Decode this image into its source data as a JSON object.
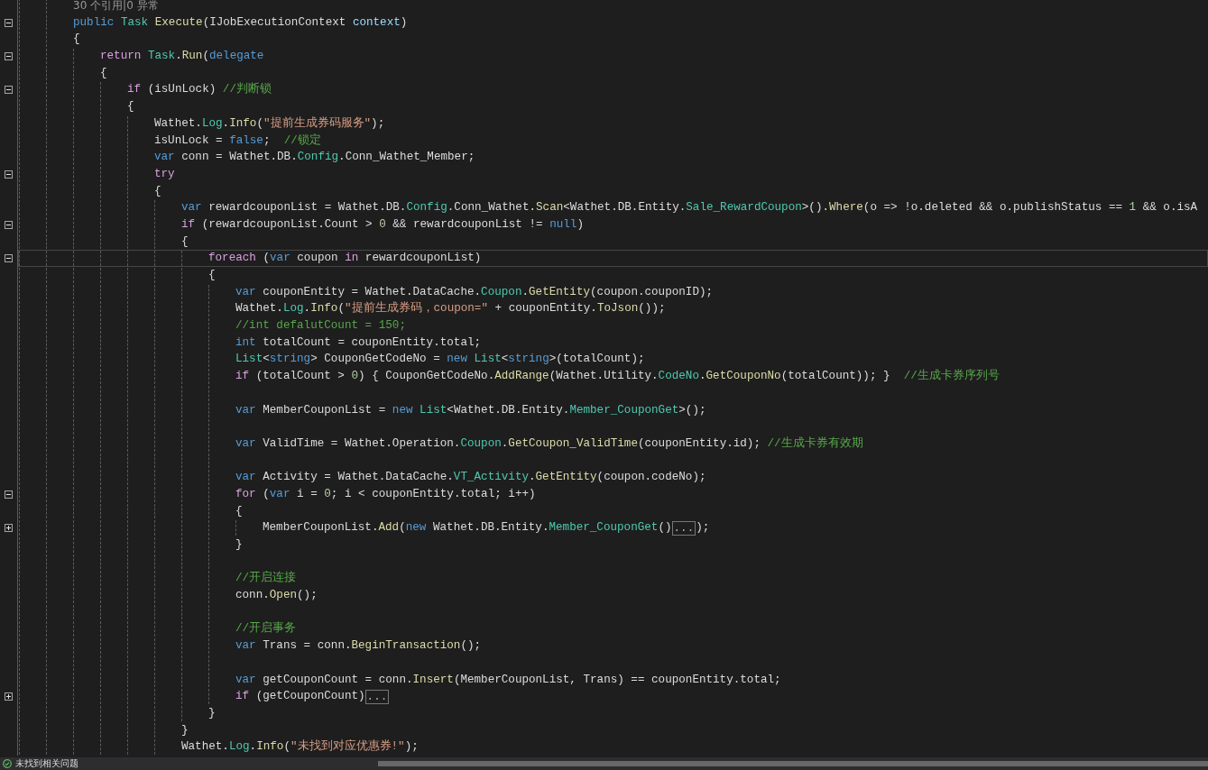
{
  "code": [
    {
      "kind": "codelens",
      "tokens": [
        {
          "kind": "lens",
          "text": "30 个引用|0 异常"
        }
      ]
    },
    {
      "kind": "code",
      "expanded": true,
      "tokens": [
        {
          "kind": "kw",
          "text": "public"
        },
        {
          "kind": "type",
          "text": " Task"
        },
        {
          "kind": "method",
          "text": " Execute"
        },
        {
          "kind": "plain",
          "text": "(IJobExecutionContext "
        },
        {
          "kind": "param",
          "text": "context"
        },
        {
          "kind": "plain",
          "text": ")"
        }
      ]
    },
    {
      "kind": "code",
      "tokens": [
        {
          "kind": "plain",
          "text": "{"
        }
      ],
      "children": [
        {
          "kind": "code",
          "expanded": true,
          "tokens": [
            {
              "kind": "ctrl",
              "text": "return"
            },
            {
              "kind": "type",
              "text": " Task"
            },
            {
              "kind": "plain",
              "text": "."
            },
            {
              "kind": "method",
              "text": "Run"
            },
            {
              "kind": "plain",
              "text": "("
            },
            {
              "kind": "kw",
              "text": "delegate"
            }
          ]
        },
        {
          "kind": "code",
          "tokens": [
            {
              "kind": "plain",
              "text": "{"
            }
          ],
          "children": [
            {
              "kind": "code",
              "expanded": true,
              "tokens": [
                {
                  "kind": "ctrl",
                  "text": "if"
                },
                {
                  "kind": "plain",
                  "text": " (isUnLock) "
                },
                {
                  "kind": "comment",
                  "text": "//判断锁"
                }
              ]
            },
            {
              "kind": "code",
              "tokens": [
                {
                  "kind": "plain",
                  "text": "{"
                }
              ],
              "children": [
                {
                  "kind": "code",
                  "tokens": [
                    {
                      "kind": "plain",
                      "text": "Wathet."
                    },
                    {
                      "kind": "type",
                      "text": "Log"
                    },
                    {
                      "kind": "plain",
                      "text": "."
                    },
                    {
                      "kind": "method",
                      "text": "Info"
                    },
                    {
                      "kind": "plain",
                      "text": "("
                    },
                    {
                      "kind": "str",
                      "text": "\"提前生成券码服务\""
                    },
                    {
                      "kind": "plain",
                      "text": ");"
                    }
                  ]
                },
                {
                  "kind": "code",
                  "tokens": [
                    {
                      "kind": "plain",
                      "text": "isUnLock = "
                    },
                    {
                      "kind": "kw",
                      "text": "false"
                    },
                    {
                      "kind": "plain",
                      "text": ";  "
                    },
                    {
                      "kind": "comment",
                      "text": "//锁定"
                    }
                  ]
                },
                {
                  "kind": "code",
                  "tokens": [
                    {
                      "kind": "kw",
                      "text": "var"
                    },
                    {
                      "kind": "plain",
                      "text": " conn = Wathet.DB."
                    },
                    {
                      "kind": "type",
                      "text": "Config"
                    },
                    {
                      "kind": "plain",
                      "text": ".Conn_Wathet_Member;"
                    }
                  ]
                },
                {
                  "kind": "code",
                  "expanded": true,
                  "tokens": [
                    {
                      "kind": "ctrl",
                      "text": "try"
                    }
                  ]
                },
                {
                  "kind": "code",
                  "tokens": [
                    {
                      "kind": "plain",
                      "text": "{"
                    }
                  ],
                  "children": [
                    {
                      "kind": "code",
                      "tokens": [
                        {
                          "kind": "kw",
                          "text": "var"
                        },
                        {
                          "kind": "plain",
                          "text": " rewardcouponList = Wathet.DB."
                        },
                        {
                          "kind": "type",
                          "text": "Config"
                        },
                        {
                          "kind": "plain",
                          "text": ".Conn_Wathet."
                        },
                        {
                          "kind": "method",
                          "text": "Scan"
                        },
                        {
                          "kind": "plain",
                          "text": "<Wathet.DB.Entity."
                        },
                        {
                          "kind": "type",
                          "text": "Sale_RewardCoupon"
                        },
                        {
                          "kind": "plain",
                          "text": ">()."
                        },
                        {
                          "kind": "method",
                          "text": "Where"
                        },
                        {
                          "kind": "plain",
                          "text": "(o => !o.deleted && o.publishStatus == "
                        },
                        {
                          "kind": "num",
                          "text": "1"
                        },
                        {
                          "kind": "plain",
                          "text": " && o.isA"
                        }
                      ]
                    },
                    {
                      "kind": "code",
                      "expanded": true,
                      "tokens": [
                        {
                          "kind": "ctrl",
                          "text": "if"
                        },
                        {
                          "kind": "plain",
                          "text": " (rewardcouponList.Count > "
                        },
                        {
                          "kind": "num",
                          "text": "0"
                        },
                        {
                          "kind": "plain",
                          "text": " && rewardcouponList != "
                        },
                        {
                          "kind": "kw",
                          "text": "null"
                        },
                        {
                          "kind": "plain",
                          "text": ")"
                        }
                      ]
                    },
                    {
                      "kind": "code",
                      "tokens": [
                        {
                          "kind": "plain",
                          "text": "{"
                        }
                      ],
                      "children": [
                        {
                          "kind": "code",
                          "expanded": true,
                          "current": true,
                          "tokens": [
                            {
                              "kind": "ctrl",
                              "text": "foreach"
                            },
                            {
                              "kind": "plain",
                              "text": " ("
                            },
                            {
                              "kind": "kw",
                              "text": "var"
                            },
                            {
                              "kind": "plain",
                              "text": " coupon "
                            },
                            {
                              "kind": "ctrl",
                              "text": "in"
                            },
                            {
                              "kind": "plain",
                              "text": " rewardcouponList)"
                            }
                          ]
                        },
                        {
                          "kind": "code",
                          "tokens": [
                            {
                              "kind": "plain",
                              "text": "{"
                            }
                          ],
                          "children": [
                            {
                              "kind": "code",
                              "tokens": [
                                {
                                  "kind": "kw",
                                  "text": "var"
                                },
                                {
                                  "kind": "plain",
                                  "text": " couponEntity = Wathet.DataCache."
                                },
                                {
                                  "kind": "type",
                                  "text": "Coupon"
                                },
                                {
                                  "kind": "plain",
                                  "text": "."
                                },
                                {
                                  "kind": "method",
                                  "text": "GetEntity"
                                },
                                {
                                  "kind": "plain",
                                  "text": "(coupon.couponID);"
                                }
                              ]
                            },
                            {
                              "kind": "code",
                              "tokens": [
                                {
                                  "kind": "plain",
                                  "text": "Wathet."
                                },
                                {
                                  "kind": "type",
                                  "text": "Log"
                                },
                                {
                                  "kind": "plain",
                                  "text": "."
                                },
                                {
                                  "kind": "method",
                                  "text": "Info"
                                },
                                {
                                  "kind": "plain",
                                  "text": "("
                                },
                                {
                                  "kind": "str",
                                  "text": "\"提前生成券码，coupon=\""
                                },
                                {
                                  "kind": "plain",
                                  "text": " + couponEntity."
                                },
                                {
                                  "kind": "method",
                                  "text": "ToJson"
                                },
                                {
                                  "kind": "plain",
                                  "text": "());"
                                }
                              ]
                            },
                            {
                              "kind": "code",
                              "tokens": [
                                {
                                  "kind": "comment",
                                  "text": "//int defalutCount = 150;"
                                }
                              ]
                            },
                            {
                              "kind": "code",
                              "tokens": [
                                {
                                  "kind": "kw",
                                  "text": "int"
                                },
                                {
                                  "kind": "plain",
                                  "text": " totalCount = couponEntity.total;"
                                }
                              ]
                            },
                            {
                              "kind": "code",
                              "tokens": [
                                {
                                  "kind": "type",
                                  "text": "List"
                                },
                                {
                                  "kind": "plain",
                                  "text": "<"
                                },
                                {
                                  "kind": "kw",
                                  "text": "string"
                                },
                                {
                                  "kind": "plain",
                                  "text": "> CouponGetCodeNo = "
                                },
                                {
                                  "kind": "kw",
                                  "text": "new"
                                },
                                {
                                  "kind": "type",
                                  "text": " List"
                                },
                                {
                                  "kind": "plain",
                                  "text": "<"
                                },
                                {
                                  "kind": "kw",
                                  "text": "string"
                                },
                                {
                                  "kind": "plain",
                                  "text": ">(totalCount);"
                                }
                              ]
                            },
                            {
                              "kind": "code",
                              "tokens": [
                                {
                                  "kind": "ctrl",
                                  "text": "if"
                                },
                                {
                                  "kind": "plain",
                                  "text": " (totalCount > "
                                },
                                {
                                  "kind": "num",
                                  "text": "0"
                                },
                                {
                                  "kind": "plain",
                                  "text": ") { CouponGetCodeNo."
                                },
                                {
                                  "kind": "method",
                                  "text": "AddRange"
                                },
                                {
                                  "kind": "plain",
                                  "text": "(Wathet.Utility."
                                },
                                {
                                  "kind": "type",
                                  "text": "CodeNo"
                                },
                                {
                                  "kind": "plain",
                                  "text": "."
                                },
                                {
                                  "kind": "method",
                                  "text": "GetCouponNo"
                                },
                                {
                                  "kind": "plain",
                                  "text": "(totalCount)); }  "
                                },
                                {
                                  "kind": "comment",
                                  "text": "//生成卡券序列号"
                                }
                              ]
                            },
                            {
                              "kind": "blank"
                            },
                            {
                              "kind": "code",
                              "tokens": [
                                {
                                  "kind": "kw",
                                  "text": "var"
                                },
                                {
                                  "kind": "plain",
                                  "text": " MemberCouponList = "
                                },
                                {
                                  "kind": "kw",
                                  "text": "new"
                                },
                                {
                                  "kind": "type",
                                  "text": " List"
                                },
                                {
                                  "kind": "plain",
                                  "text": "<Wathet.DB.Entity."
                                },
                                {
                                  "kind": "type",
                                  "text": "Member_CouponGet"
                                },
                                {
                                  "kind": "plain",
                                  "text": ">();"
                                }
                              ]
                            },
                            {
                              "kind": "blank"
                            },
                            {
                              "kind": "code",
                              "tokens": [
                                {
                                  "kind": "kw",
                                  "text": "var"
                                },
                                {
                                  "kind": "plain",
                                  "text": " ValidTime = Wathet.Operation."
                                },
                                {
                                  "kind": "type",
                                  "text": "Coupon"
                                },
                                {
                                  "kind": "plain",
                                  "text": "."
                                },
                                {
                                  "kind": "method",
                                  "text": "GetCoupon_ValidTime"
                                },
                                {
                                  "kind": "plain",
                                  "text": "(couponEntity.id); "
                                },
                                {
                                  "kind": "comment",
                                  "text": "//生成卡券有效期"
                                }
                              ]
                            },
                            {
                              "kind": "blank"
                            },
                            {
                              "kind": "code",
                              "tokens": [
                                {
                                  "kind": "kw",
                                  "text": "var"
                                },
                                {
                                  "kind": "plain",
                                  "text": " Activity = Wathet.DataCache."
                                },
                                {
                                  "kind": "type",
                                  "text": "VT_Activity"
                                },
                                {
                                  "kind": "plain",
                                  "text": "."
                                },
                                {
                                  "kind": "method",
                                  "text": "GetEntity"
                                },
                                {
                                  "kind": "plain",
                                  "text": "(coupon.codeNo);"
                                }
                              ]
                            },
                            {
                              "kind": "code",
                              "expanded": true,
                              "tokens": [
                                {
                                  "kind": "ctrl",
                                  "text": "for"
                                },
                                {
                                  "kind": "plain",
                                  "text": " ("
                                },
                                {
                                  "kind": "kw",
                                  "text": "var"
                                },
                                {
                                  "kind": "plain",
                                  "text": " i = "
                                },
                                {
                                  "kind": "num",
                                  "text": "0"
                                },
                                {
                                  "kind": "plain",
                                  "text": "; i < couponEntity.total; i++)"
                                }
                              ]
                            },
                            {
                              "kind": "code",
                              "tokens": [
                                {
                                  "kind": "plain",
                                  "text": "{"
                                }
                              ],
                              "children": [
                                {
                                  "kind": "code",
                                  "expanded": false,
                                  "tokens": [
                                    {
                                      "kind": "plain",
                                      "text": "MemberCouponList."
                                    },
                                    {
                                      "kind": "method",
                                      "text": "Add"
                                    },
                                    {
                                      "kind": "plain",
                                      "text": "("
                                    },
                                    {
                                      "kind": "kw",
                                      "text": "new"
                                    },
                                    {
                                      "kind": "plain",
                                      "text": " Wathet.DB.Entity."
                                    },
                                    {
                                      "kind": "type",
                                      "text": "Member_CouponGet"
                                    },
                                    {
                                      "kind": "plain",
                                      "text": "()"
                                    },
                                    {
                                      "kind": "folded",
                                      "text": "..."
                                    },
                                    {
                                      "kind": "plain",
                                      "text": ");"
                                    }
                                  ]
                                }
                              ]
                            },
                            {
                              "kind": "code",
                              "tokens": [
                                {
                                  "kind": "plain",
                                  "text": "}"
                                }
                              ]
                            },
                            {
                              "kind": "blank"
                            },
                            {
                              "kind": "code",
                              "tokens": [
                                {
                                  "kind": "comment",
                                  "text": "//开启连接"
                                }
                              ]
                            },
                            {
                              "kind": "code",
                              "tokens": [
                                {
                                  "kind": "plain",
                                  "text": "conn."
                                },
                                {
                                  "kind": "method",
                                  "text": "Open"
                                },
                                {
                                  "kind": "plain",
                                  "text": "();"
                                }
                              ]
                            },
                            {
                              "kind": "blank"
                            },
                            {
                              "kind": "code",
                              "tokens": [
                                {
                                  "kind": "comment",
                                  "text": "//开启事务"
                                }
                              ]
                            },
                            {
                              "kind": "code",
                              "tokens": [
                                {
                                  "kind": "kw",
                                  "text": "var"
                                },
                                {
                                  "kind": "plain",
                                  "text": " Trans = conn."
                                },
                                {
                                  "kind": "method",
                                  "text": "BeginTransaction"
                                },
                                {
                                  "kind": "plain",
                                  "text": "();"
                                }
                              ]
                            },
                            {
                              "kind": "blank"
                            },
                            {
                              "kind": "code",
                              "tokens": [
                                {
                                  "kind": "kw",
                                  "text": "var"
                                },
                                {
                                  "kind": "plain",
                                  "text": " getCouponCount = conn."
                                },
                                {
                                  "kind": "method",
                                  "text": "Insert"
                                },
                                {
                                  "kind": "plain",
                                  "text": "(MemberCouponList, Trans) == couponEntity.total;"
                                }
                              ]
                            },
                            {
                              "kind": "code",
                              "expanded": false,
                              "tokens": [
                                {
                                  "kind": "ctrl",
                                  "text": "if"
                                },
                                {
                                  "kind": "plain",
                                  "text": " (getCouponCount)"
                                },
                                {
                                  "kind": "folded",
                                  "text": "..."
                                }
                              ]
                            }
                          ]
                        },
                        {
                          "kind": "code",
                          "tokens": [
                            {
                              "kind": "plain",
                              "text": "}"
                            }
                          ]
                        }
                      ]
                    },
                    {
                      "kind": "code",
                      "tokens": [
                        {
                          "kind": "plain",
                          "text": "}"
                        }
                      ]
                    },
                    {
                      "kind": "code",
                      "tokens": [
                        {
                          "kind": "plain",
                          "text": "Wathet."
                        },
                        {
                          "kind": "type",
                          "text": "Log"
                        },
                        {
                          "kind": "plain",
                          "text": "."
                        },
                        {
                          "kind": "method",
                          "text": "Info"
                        },
                        {
                          "kind": "plain",
                          "text": "("
                        },
                        {
                          "kind": "str",
                          "text": "\"未找到对应优惠券!\""
                        },
                        {
                          "kind": "plain",
                          "text": ");"
                        }
                      ]
                    }
                  ]
                }
              ]
            }
          ]
        }
      ]
    }
  ],
  "status_bar": {
    "text": "未找到相关问题"
  }
}
